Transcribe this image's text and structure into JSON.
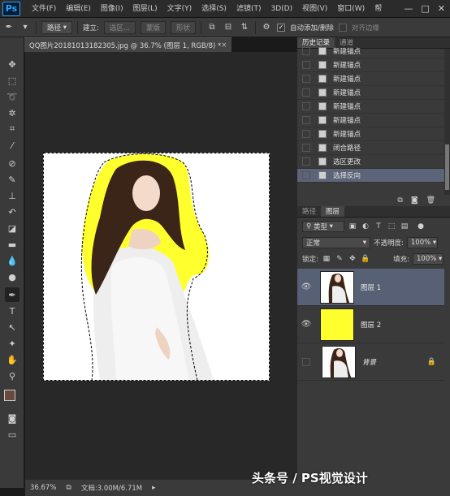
{
  "app": {
    "logo": "Ps"
  },
  "menu": [
    "文件(F)",
    "编辑(E)",
    "图像(I)",
    "图层(L)",
    "文字(Y)",
    "选择(S)",
    "滤镜(T)",
    "3D(D)",
    "视图(V)",
    "窗口(W)",
    "帮"
  ],
  "window_controls": {
    "minimize": "—",
    "restore": "□",
    "close": "✕"
  },
  "options_bar": {
    "mode": "路径",
    "build_label": "建立:",
    "selection_btn": "选区...",
    "mask_btn": "蒙版",
    "shape_btn": "形状",
    "auto_add_label": "自动添加/删除",
    "align_edges_label": "对齐边缘"
  },
  "document": {
    "tab_title": "QQ图片20181013182305.jpg @ 36.7% (图层 1, RGB/8) *",
    "zoom": "36.67%",
    "doc_info": "文档:3.00M/6.71M"
  },
  "history_panel": {
    "tabs": [
      "历史记录",
      "通道"
    ],
    "items": [
      {
        "label": "新建锚点",
        "selected": false
      },
      {
        "label": "新建锚点",
        "selected": false
      },
      {
        "label": "新建锚点",
        "selected": false
      },
      {
        "label": "新建锚点",
        "selected": false
      },
      {
        "label": "新建锚点",
        "selected": false
      },
      {
        "label": "新建锚点",
        "selected": false
      },
      {
        "label": "新建锚点",
        "selected": false
      },
      {
        "label": "闭合路径",
        "selected": false
      },
      {
        "label": "选区更改",
        "selected": false
      },
      {
        "label": "选择反向",
        "selected": true
      }
    ]
  },
  "layers_panel": {
    "tabs": [
      "路径",
      "图层"
    ],
    "filter_label": "类型",
    "blend_mode": "正常",
    "opacity_label": "不透明度:",
    "opacity": "100%",
    "lock_label": "锁定:",
    "fill_label": "填充:",
    "fill": "100%",
    "layers": [
      {
        "name": "图层 1",
        "thumb": "photo",
        "selected": true,
        "visible": true,
        "locked": false
      },
      {
        "name": "图层 2",
        "thumb": "yellow",
        "selected": false,
        "visible": true,
        "locked": false
      },
      {
        "name": "背景",
        "thumb": "photo",
        "selected": false,
        "visible": false,
        "locked": true
      }
    ]
  },
  "colors": {
    "highlight_yellow": "#ffff2e",
    "selection_blue": "#5b6478",
    "foreground": "#6b4a3e",
    "background": "#ffffff"
  },
  "watermark": "头条号 / PS视觉设计"
}
